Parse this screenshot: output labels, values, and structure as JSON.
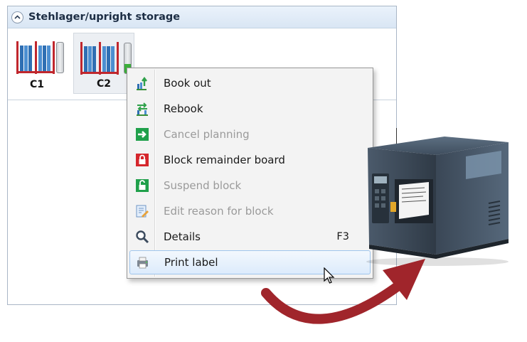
{
  "panel": {
    "title": "Stehlager/upright storage",
    "slots": [
      {
        "label": "C1",
        "fill_fraction": 0.0,
        "selected": false
      },
      {
        "label": "C2",
        "fill_fraction": 0.3,
        "selected": true
      }
    ]
  },
  "context_menu": {
    "items": [
      {
        "label": "Book out",
        "icon": "book-out-icon",
        "enabled": true,
        "shortcut": ""
      },
      {
        "label": "Rebook",
        "icon": "rebook-icon",
        "enabled": true,
        "shortcut": ""
      },
      {
        "label": "Cancel planning",
        "icon": "cancel-planning-icon",
        "enabled": false,
        "shortcut": ""
      },
      {
        "label": "Block remainder board",
        "icon": "lock-red-icon",
        "enabled": true,
        "shortcut": ""
      },
      {
        "label": "Suspend block",
        "icon": "unlock-green-icon",
        "enabled": false,
        "shortcut": ""
      },
      {
        "label": "Edit reason for block",
        "icon": "edit-note-icon",
        "enabled": false,
        "shortcut": ""
      },
      {
        "label": "Details",
        "icon": "magnifier-icon",
        "enabled": true,
        "shortcut": "F3"
      },
      {
        "label": "Print label",
        "icon": "printer-icon",
        "enabled": true,
        "shortcut": "",
        "highlighted": true
      }
    ]
  },
  "colors": {
    "accent_green": "#3bae3a",
    "lock_red": "#d5262c",
    "arrow_red": "#a0252b",
    "highlight_border": "#9fc5ec"
  }
}
